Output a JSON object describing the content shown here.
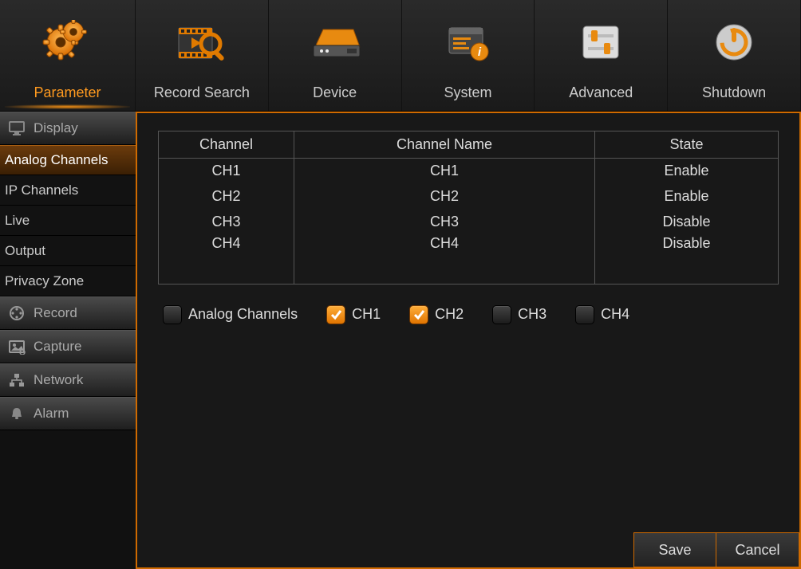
{
  "topnav": {
    "items": [
      {
        "label": "Parameter",
        "active": true
      },
      {
        "label": "Record Search"
      },
      {
        "label": "Device"
      },
      {
        "label": "System"
      },
      {
        "label": "Advanced"
      },
      {
        "label": "Shutdown"
      }
    ]
  },
  "sidebar": {
    "categories": [
      {
        "label": "Display",
        "subitems": [
          {
            "label": "Analog Channels",
            "active": true
          },
          {
            "label": "IP Channels"
          },
          {
            "label": "Live"
          },
          {
            "label": "Output"
          },
          {
            "label": "Privacy Zone"
          }
        ]
      },
      {
        "label": "Record"
      },
      {
        "label": "Capture"
      },
      {
        "label": "Network"
      },
      {
        "label": "Alarm"
      }
    ]
  },
  "table": {
    "headers": {
      "channel": "Channel",
      "name": "Channel Name",
      "state": "State"
    },
    "rows": [
      {
        "channel": "CH1",
        "name": "CH1",
        "state": "Enable"
      },
      {
        "channel": "CH2",
        "name": "CH2",
        "state": "Enable"
      },
      {
        "channel": "CH3",
        "name": "CH3",
        "state": "Disable"
      },
      {
        "channel": "CH4",
        "name": "CH4",
        "state": "Disable"
      }
    ]
  },
  "checks": {
    "all_label": "Analog Channels",
    "items": [
      {
        "label": "CH1",
        "checked": true
      },
      {
        "label": "CH2",
        "checked": true
      },
      {
        "label": "CH3",
        "checked": false
      },
      {
        "label": "CH4",
        "checked": false
      }
    ]
  },
  "buttons": {
    "save": "Save",
    "cancel": "Cancel"
  },
  "colors": {
    "accent": "#ff8c1a"
  }
}
